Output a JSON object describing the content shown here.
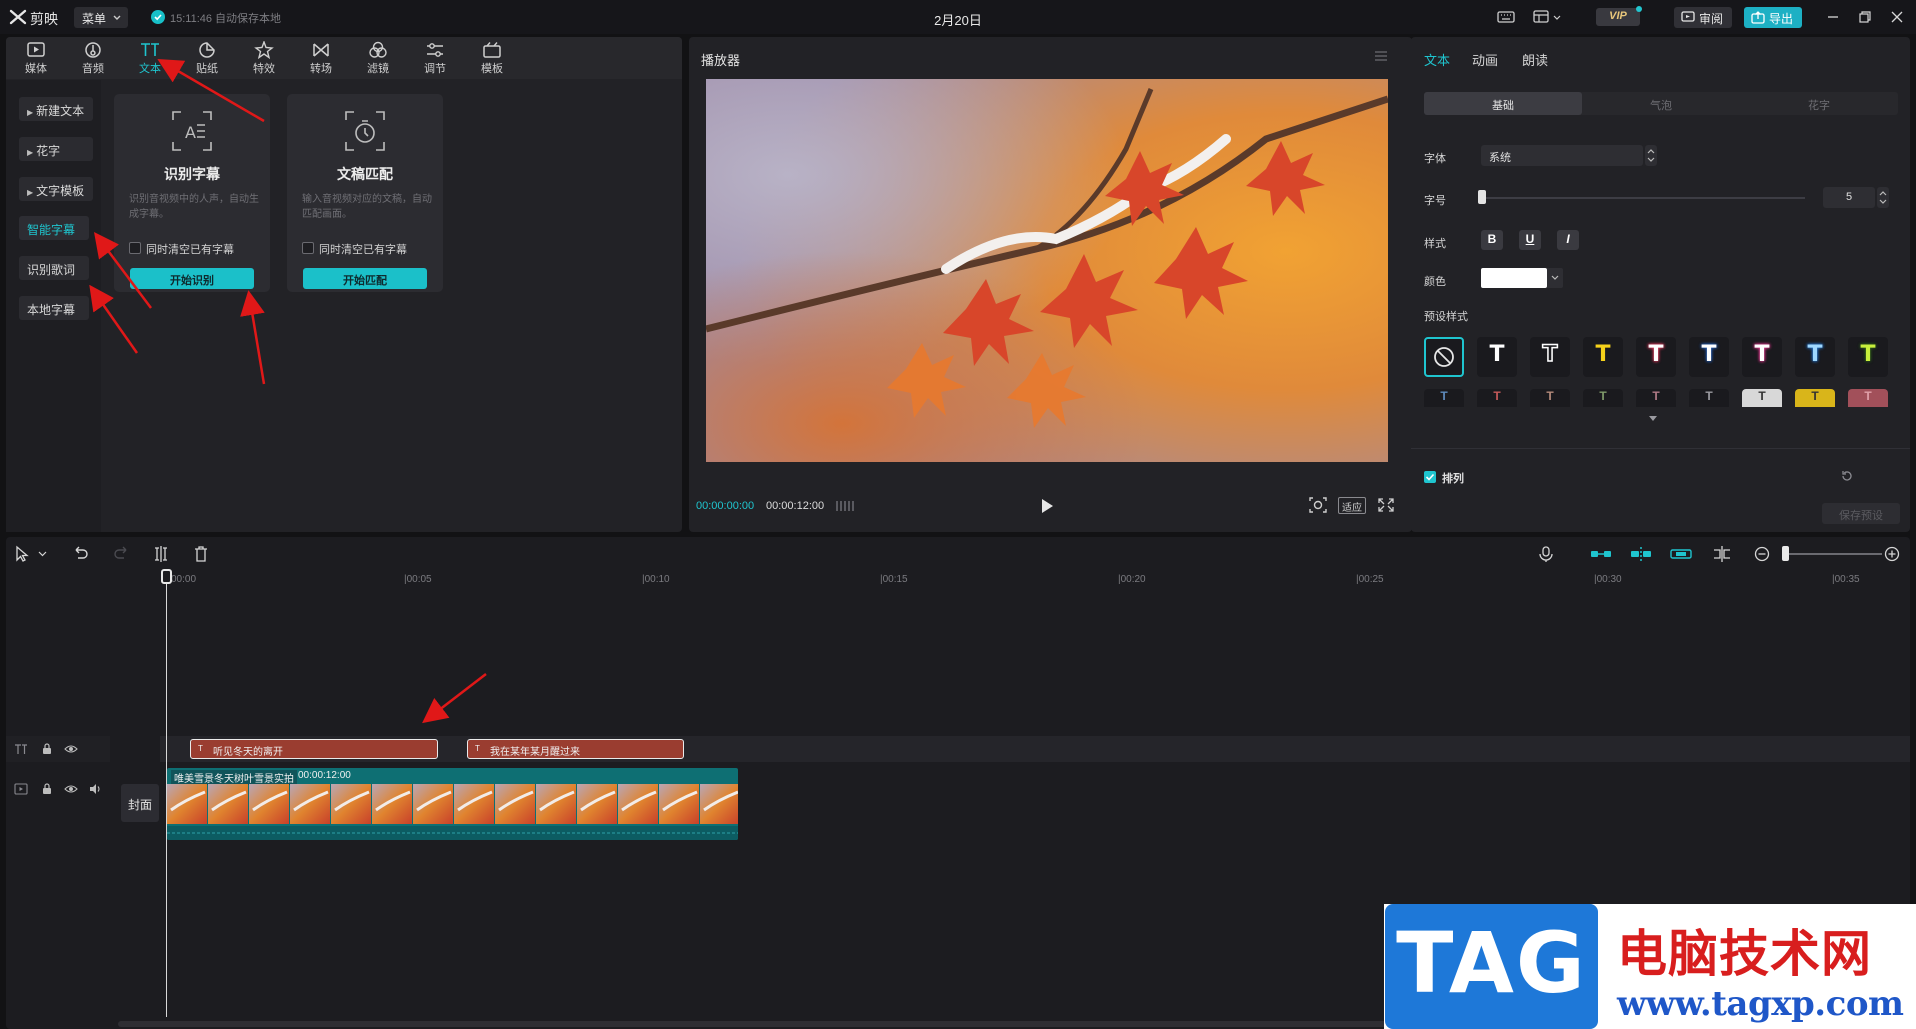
{
  "titlebar": {
    "app_name": "剪映",
    "menu_label": "菜单",
    "save_status": "15:11:46 自动保存本地",
    "date": "2月20日",
    "vip_label": "VIP",
    "review_label": "审阅",
    "export_label": "导出"
  },
  "media_toolbar": {
    "items": [
      {
        "label": "媒体",
        "icon": "media-icon"
      },
      {
        "label": "音频",
        "icon": "audio-icon"
      },
      {
        "label": "文本",
        "icon": "text-icon"
      },
      {
        "label": "贴纸",
        "icon": "sticker-icon"
      },
      {
        "label": "特效",
        "icon": "effects-icon"
      },
      {
        "label": "转场",
        "icon": "transition-icon"
      },
      {
        "label": "滤镜",
        "icon": "filter-icon"
      },
      {
        "label": "调节",
        "icon": "adjust-icon"
      },
      {
        "label": "模板",
        "icon": "template-icon"
      }
    ],
    "active": "文本"
  },
  "text_sidebar": {
    "items": [
      {
        "label": "新建文本",
        "expandable": true
      },
      {
        "label": "花字",
        "expandable": true
      },
      {
        "label": "文字模板",
        "expandable": true
      },
      {
        "label": "智能字幕",
        "expandable": false,
        "active": true
      },
      {
        "label": "识别歌词",
        "expandable": false
      },
      {
        "label": "本地字幕",
        "expandable": false
      }
    ]
  },
  "cards": [
    {
      "title": "识别字幕",
      "desc": "识别音视频中的人声，自动生成字幕。",
      "checkbox_label": "同时清空已有字幕",
      "button_label": "开始识别"
    },
    {
      "title": "文稿匹配",
      "desc": "输入音视频对应的文稿，自动匹配画面。",
      "checkbox_label": "同时清空已有字幕",
      "button_label": "开始匹配"
    }
  ],
  "player": {
    "title": "播放器",
    "current_time": "00:00:00:00",
    "total_time": "00:00:12:00",
    "fit_label": "适应"
  },
  "properties": {
    "tabs": [
      "文本",
      "动画",
      "朗读"
    ],
    "active_tab": "文本",
    "segments": [
      "基础",
      "气泡",
      "花字"
    ],
    "active_segment": "基础",
    "font_label": "字体",
    "font_value": "系统",
    "size_label": "字号",
    "size_value": "5",
    "size_fraction": 0.0,
    "style_label": "样式",
    "style_buttons": [
      "B",
      "U",
      "I"
    ],
    "color_label": "颜色",
    "color_value": "#ffffff",
    "preset_label": "预设样式",
    "arrange_label": "排列",
    "save_preset_label": "保存预设"
  },
  "timeline": {
    "ruler": [
      "00:00",
      "|00:05",
      "|00:10",
      "|00:15",
      "|00:20",
      "|00:25",
      "|00:30",
      "|00:35"
    ],
    "cover_label": "封面",
    "text_clips": [
      "听见冬天的离开",
      "我在某年某月醒过来"
    ],
    "video_clip": {
      "title": "唯美雪景冬天树叶雪景实拍",
      "duration": "00:00:12:00"
    }
  },
  "watermark": {
    "tag": "TAG",
    "site_name": "电脑技术网",
    "url": "www.tagxp.com"
  },
  "colors": {
    "accent": "#1fc5cf",
    "text_clip": "#9a3d30",
    "video_clip": "#0e6f73",
    "export": "#1db0c4"
  }
}
